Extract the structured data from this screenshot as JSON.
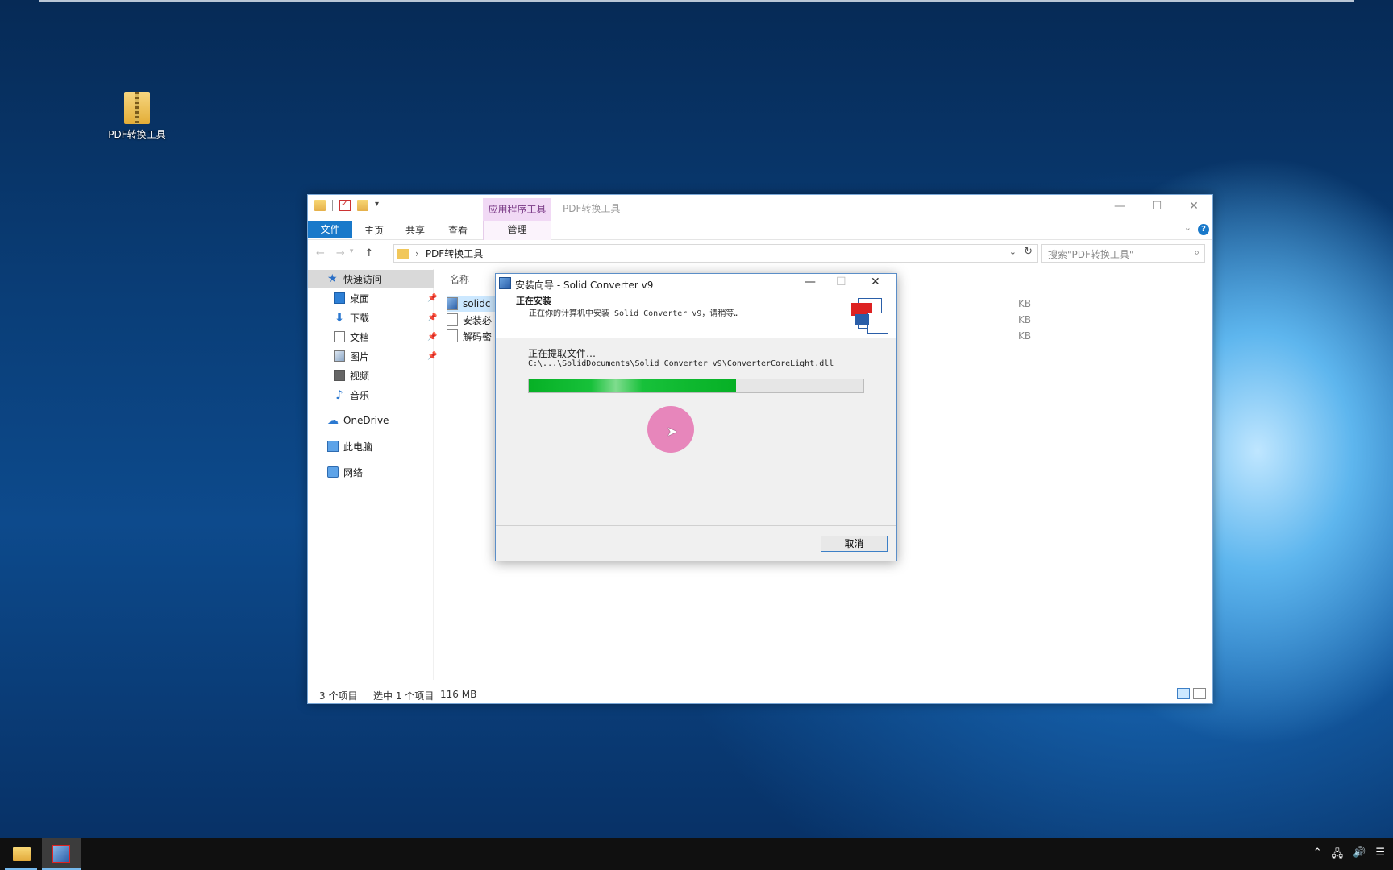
{
  "desktop": {
    "icon_label": "PDF转换工具"
  },
  "explorer": {
    "context_tab": "应用程序工具",
    "window_title": "PDF转换工具",
    "ribbon": {
      "file": "文件",
      "home": "主页",
      "share": "共享",
      "view": "查看",
      "manage": "管理"
    },
    "address": "PDF转换工具",
    "search_placeholder": "搜索\"PDF转换工具\"",
    "nav": {
      "quick_access": "快速访问",
      "desktop": "桌面",
      "downloads": "下载",
      "documents": "文档",
      "pictures": "图片",
      "videos": "视频",
      "music": "音乐",
      "onedrive": "OneDrive",
      "this_pc": "此电脑",
      "network": "网络"
    },
    "column_name": "名称",
    "files": [
      {
        "name": "solidc",
        "size_suffix": "KB"
      },
      {
        "name": "安装必",
        "size_suffix": "KB"
      },
      {
        "name": "解码密",
        "size_suffix": "KB"
      }
    ],
    "status": {
      "count": "3 个项目",
      "selected": "选中 1 个项目",
      "size": "116 MB"
    }
  },
  "installer": {
    "title": "安装向导 - Solid Converter v9",
    "heading": "正在安装",
    "subheading": "正在你的计算机中安装 Solid Converter v9，请稍等…",
    "status": "正在提取文件…",
    "path": "C:\\...\\SolidDocuments\\Solid Converter v9\\ConverterCoreLight.dll",
    "progress": 0.62,
    "cancel": "取消"
  },
  "icons": {
    "minimize": "minimize-icon",
    "maximize": "maximize-icon",
    "close": "close-icon"
  }
}
